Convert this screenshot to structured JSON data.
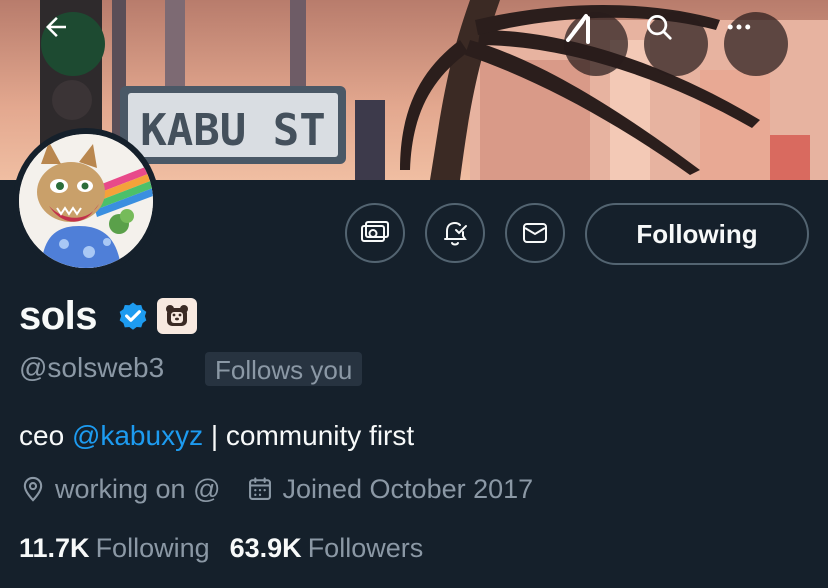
{
  "banner": {
    "street_sign": "KABU ST"
  },
  "header_buttons": {
    "back": "arrow-left-icon",
    "grok": "grok-icon",
    "search": "search-icon",
    "more": "more-icon"
  },
  "profile": {
    "display_name": "sols",
    "handle": "@solsweb3",
    "follows_you": "Follows you",
    "verified": true,
    "affiliate_badge": "bear-face-icon",
    "bio": {
      "prefix": "ceo ",
      "mention": "@kabuxyz",
      "suffix": " | community first"
    },
    "location": "working on @",
    "joined": "Joined October 2017",
    "stats": {
      "following_count": "11.7K",
      "following_label": "Following",
      "followers_count": "63.9K",
      "followers_label": "Followers"
    }
  },
  "actions": {
    "tips": "money-icon",
    "notify": "bell-check-icon",
    "message": "envelope-icon",
    "following_label": "Following"
  },
  "colors": {
    "background": "#15202b",
    "accent": "#1d9bf0",
    "secondary_text": "#8b98a5",
    "border": "#536471",
    "back_button": "#1d4a31"
  }
}
